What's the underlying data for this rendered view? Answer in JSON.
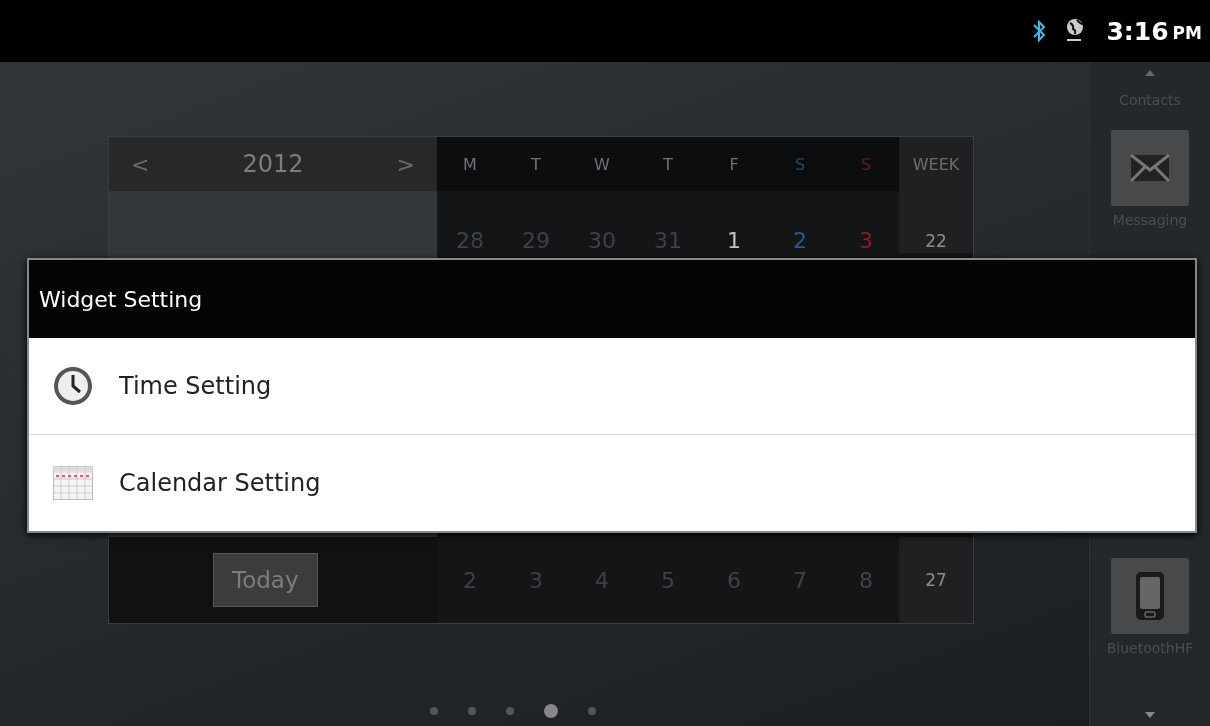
{
  "status_bar": {
    "time": "3:16",
    "ampm": "PM"
  },
  "calendar": {
    "year": "2012",
    "prev": "<",
    "next": ">",
    "day_headers": [
      {
        "label": "M",
        "kind": "weekday"
      },
      {
        "label": "T",
        "kind": "weekday"
      },
      {
        "label": "W",
        "kind": "weekday"
      },
      {
        "label": "T",
        "kind": "weekday"
      },
      {
        "label": "F",
        "kind": "weekday"
      },
      {
        "label": "S",
        "kind": "saturday"
      },
      {
        "label": "S",
        "kind": "sunday"
      }
    ],
    "week_header": "WEEK",
    "rows": [
      {
        "days": [
          {
            "label": "28",
            "kind": "other"
          },
          {
            "label": "29",
            "kind": "other"
          },
          {
            "label": "30",
            "kind": "other"
          },
          {
            "label": "31",
            "kind": "other"
          },
          {
            "label": "1",
            "kind": "weekday"
          },
          {
            "label": "2",
            "kind": "saturday"
          },
          {
            "label": "3",
            "kind": "sunday"
          }
        ],
        "week": "22"
      },
      {
        "days": [
          {
            "label": "2",
            "kind": "other"
          },
          {
            "label": "3",
            "kind": "other"
          },
          {
            "label": "4",
            "kind": "other"
          },
          {
            "label": "5",
            "kind": "other"
          },
          {
            "label": "6",
            "kind": "other"
          },
          {
            "label": "7",
            "kind": "other"
          },
          {
            "label": "8",
            "kind": "other"
          }
        ],
        "week": "27"
      }
    ],
    "today_button": "Today"
  },
  "dock": {
    "items": [
      {
        "label": "Contacts",
        "kind": "none"
      },
      {
        "label": "Messaging",
        "kind": "mail"
      },
      {
        "label": "BluetoothHF",
        "kind": "phone"
      }
    ]
  },
  "page_dots": [
    {
      "selected": false
    },
    {
      "selected": false
    },
    {
      "selected": false
    },
    {
      "selected": true
    },
    {
      "selected": false
    }
  ],
  "dialog": {
    "title": "Widget Setting",
    "items": [
      {
        "label": "Time Setting",
        "kind": "clock"
      },
      {
        "label": "Calendar Setting",
        "kind": "calendar"
      }
    ]
  }
}
